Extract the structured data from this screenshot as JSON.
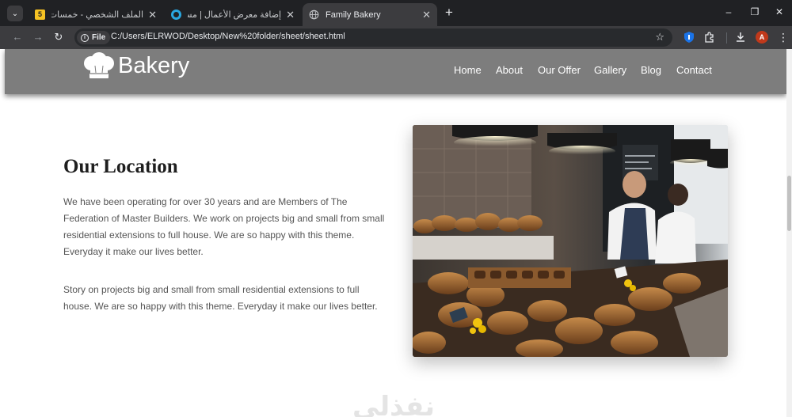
{
  "browser": {
    "tabs": [
      {
        "title": "الملف الشخصي - خمسات",
        "badge": "5",
        "active": false
      },
      {
        "title": "إضافة معرض الأعمال | مستقل",
        "active": false
      },
      {
        "title": "Family Bakery",
        "active": true
      }
    ],
    "new_tab_symbol": "+",
    "window_controls": {
      "minimize": "–",
      "restore": "❐",
      "close": "✕"
    },
    "address": {
      "scheme_label": "File",
      "url": "C:/Users/ELRWOD/Desktop/New%20folder/sheet/sheet.html"
    },
    "profile_initial": "A"
  },
  "site": {
    "logo_text": "Bakery",
    "nav": [
      "Home",
      "About",
      "Our Offer",
      "Gallery",
      "Blog",
      "Contact"
    ],
    "section": {
      "title": "Our Location",
      "paragraph1": "We have been operating for over 30 years and are Members of The Federation of Master Builders. We work on projects big and small from small residential extensions to full house. We are so happy with this theme. Everyday it make our lives better.",
      "paragraph2": "Story on projects big and small from small residential extensions to full house. We are so happy with this theme. Everyday it make our lives better."
    },
    "watermark": "نفذلي"
  },
  "colors": {
    "header_bg": "#7d7d7d",
    "tabbar_bg": "#202124",
    "toolbar_bg": "#3c3c3f",
    "title_color": "#1e1e1e",
    "text_color": "#555555"
  },
  "icons": [
    "chef-hat-icon",
    "search-tabs-icon",
    "globe-icon",
    "back-arrow-icon",
    "forward-arrow-icon",
    "reload-icon",
    "info-icon",
    "star-icon",
    "shield-icon",
    "extensions-icon",
    "download-icon",
    "menu-icon"
  ]
}
